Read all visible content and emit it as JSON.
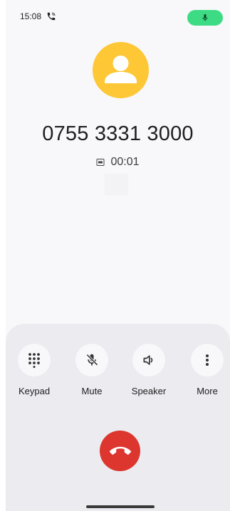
{
  "status_bar": {
    "time": "15:08",
    "call_icon": "wifi-call-icon",
    "mic_icon": "mic-icon",
    "mic_pill_color": "#3ddc84"
  },
  "caller": {
    "avatar_icon": "person-avatar-icon",
    "avatar_color": "#fdc735",
    "number": "0755 3331 3000",
    "sim_icon": "sim-card-icon",
    "duration": "00:01"
  },
  "actions": [
    {
      "label": "Keypad",
      "icon": "dialpad-icon"
    },
    {
      "label": "Mute",
      "icon": "mic-off-icon"
    },
    {
      "label": "Speaker",
      "icon": "volume-icon"
    },
    {
      "label": "More",
      "icon": "more-vert-icon"
    }
  ],
  "end_call": {
    "icon": "call-end-icon",
    "color": "#dc362e"
  }
}
